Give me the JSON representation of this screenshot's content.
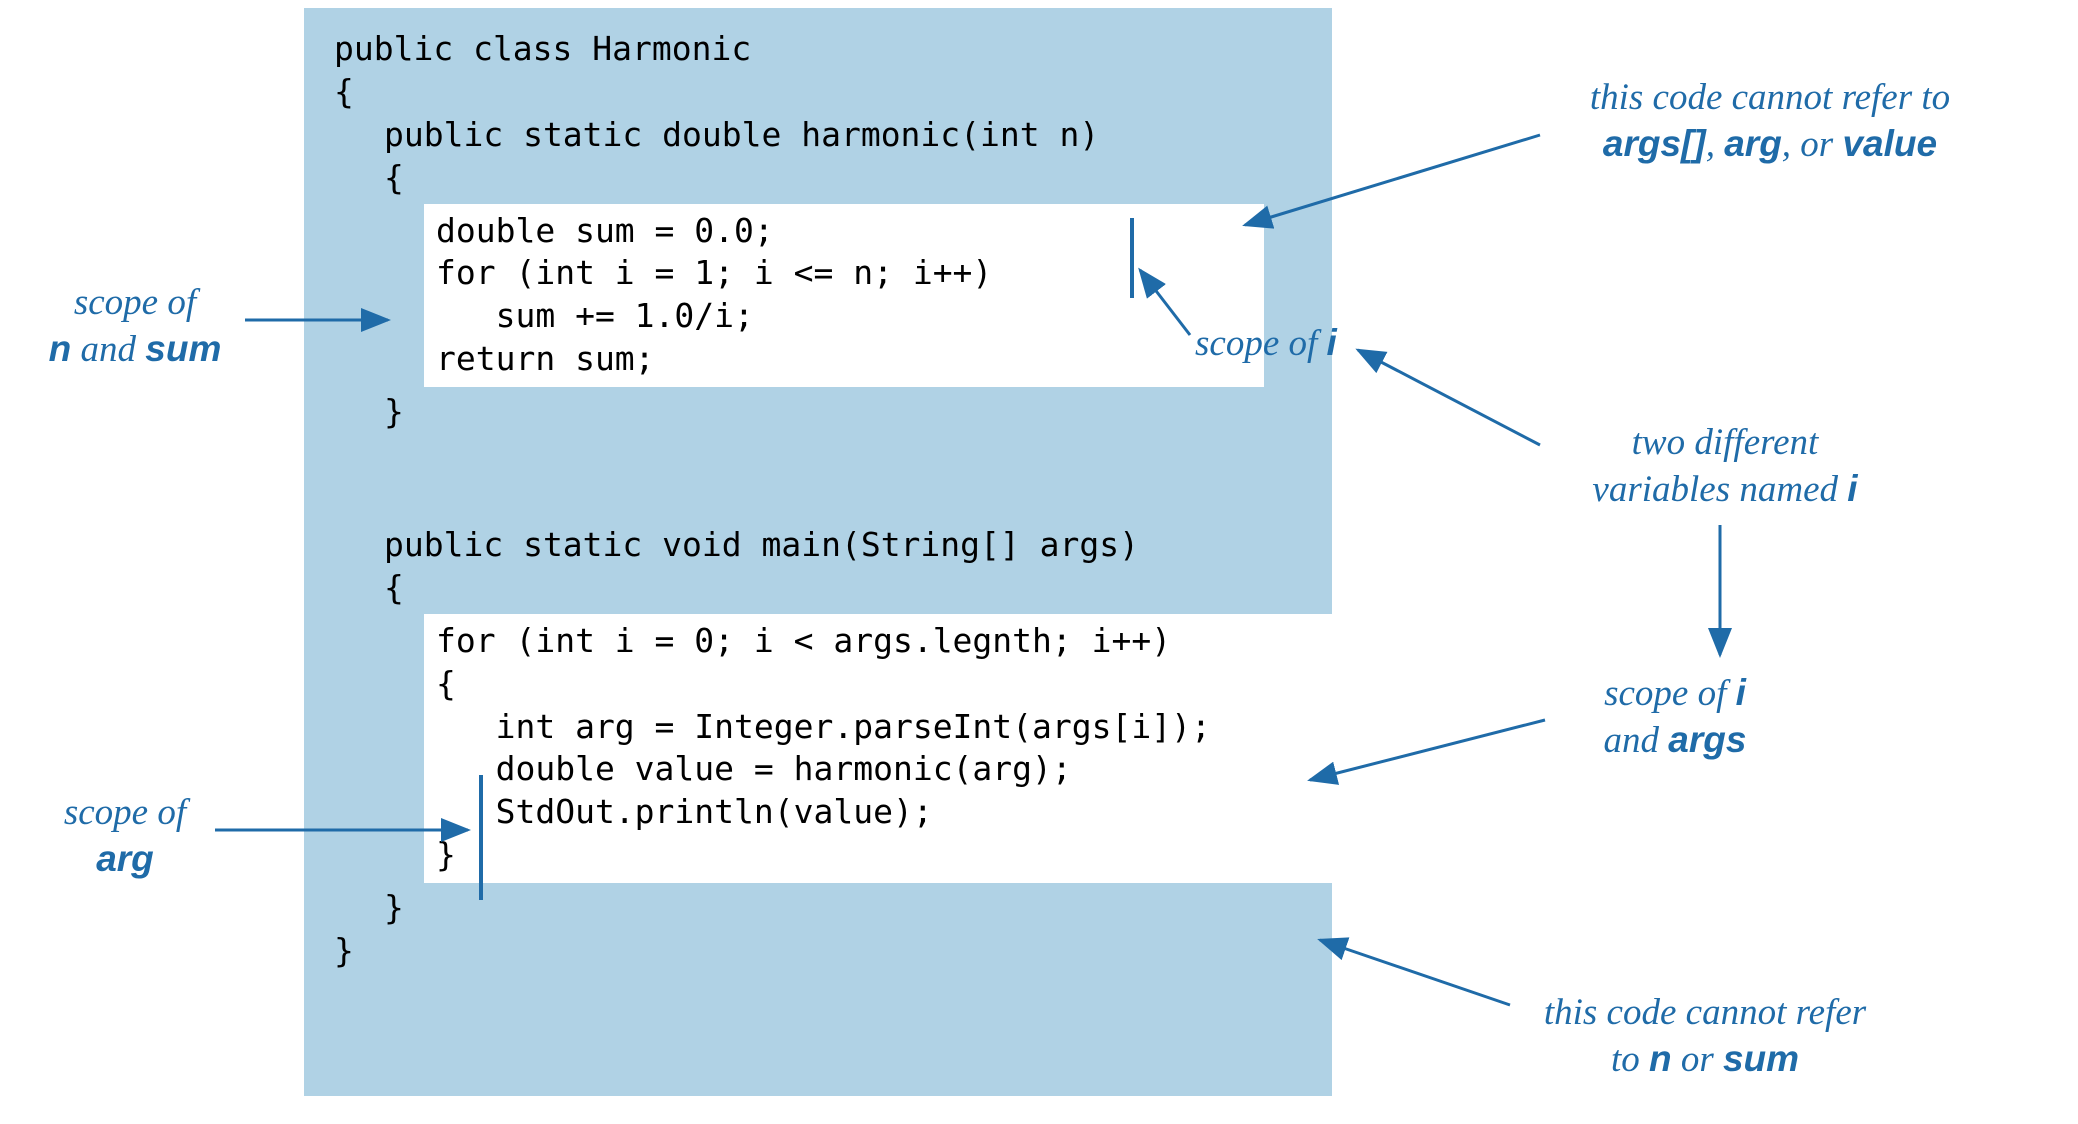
{
  "code": {
    "l1": "public class Harmonic",
    "l2": "{",
    "l3": "public static double harmonic(int n)",
    "l4": "{",
    "box1_l1": "double sum = 0.0;",
    "box1_l2": "for (int i = 1; i <= n; i++)",
    "box1_l3": "   sum += 1.0/i;",
    "box1_l4": "return sum;",
    "l5": "}",
    "l6": "public static void main(String[] args)",
    "l7": "{",
    "box2_l1": "for (int i = 0; i < args.legnth; i++)",
    "box2_l2": "{",
    "box2_l3": "   int arg = Integer.parseInt(args[i]);",
    "box2_l4": "   double value = harmonic(arg);",
    "box2_l5": "   StdOut.println(value);",
    "box2_l6": "}",
    "l8": "}",
    "l9": "}"
  },
  "labels": {
    "scope_n_sum_1": "scope of",
    "scope_n_sum_2a": "n",
    "scope_n_sum_2b": " and ",
    "scope_n_sum_2c": "sum",
    "scope_i_1": "scope of ",
    "scope_i_1b": "i",
    "cannot_refer_top_1": "this code cannot refer to",
    "cannot_refer_top_2a": "args[]",
    "cannot_refer_top_2b": ", ",
    "cannot_refer_top_2c": "arg",
    "cannot_refer_top_2d": ", or ",
    "cannot_refer_top_2e": "value",
    "two_diff_1": "two different",
    "two_diff_2a": "variables named ",
    "two_diff_2b": "i",
    "scope_i_args_1": "scope of ",
    "scope_i_args_1b": "i",
    "scope_i_args_2a": "and ",
    "scope_i_args_2b": "args",
    "scope_arg_1": "scope of",
    "scope_arg_2": "arg",
    "cannot_refer_bot_1": "this code cannot refer",
    "cannot_refer_bot_2a": "to ",
    "cannot_refer_bot_2b": "n",
    "cannot_refer_bot_2c": " or ",
    "cannot_refer_bot_2d": "sum"
  },
  "colors": {
    "accent": "#1f6ba8",
    "code_bg": "#b0d2e5",
    "white": "#ffffff"
  }
}
